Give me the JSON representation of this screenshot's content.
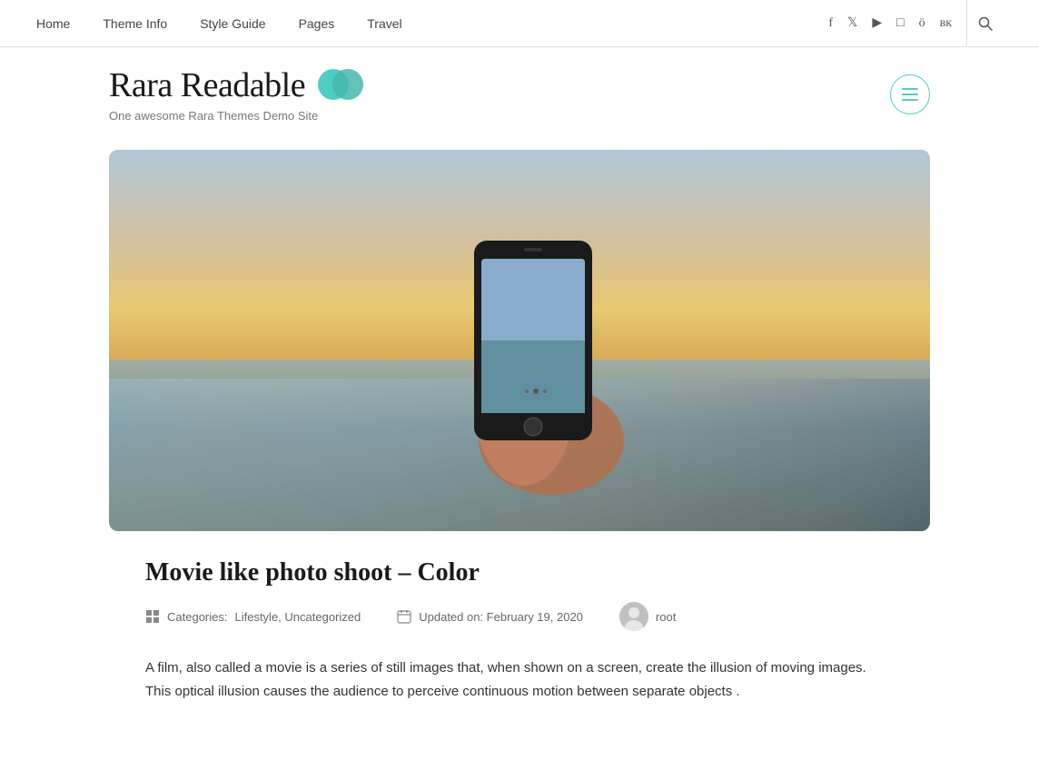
{
  "topnav": {
    "links": [
      {
        "label": "Home",
        "id": "home"
      },
      {
        "label": "Theme Info",
        "id": "theme-info"
      },
      {
        "label": "Style Guide",
        "id": "style-guide"
      },
      {
        "label": "Pages",
        "id": "pages"
      },
      {
        "label": "Travel",
        "id": "travel"
      }
    ],
    "social": [
      {
        "id": "facebook",
        "symbol": "f"
      },
      {
        "id": "twitter",
        "symbol": "𝕏"
      },
      {
        "id": "youtube",
        "symbol": "▶"
      },
      {
        "id": "instagram",
        "symbol": "◻"
      },
      {
        "id": "odnoklassniki",
        "symbol": "ö"
      },
      {
        "id": "vk",
        "symbol": "в"
      }
    ],
    "search_symbol": "🔍"
  },
  "header": {
    "site_title": "Rara Readable",
    "tagline": "One awesome Rara Themes Demo Site",
    "menu_label": "menu"
  },
  "article": {
    "title": "Movie like photo shoot – Color",
    "categories_label": "Categories:",
    "categories": "Lifestyle, Uncategorized",
    "updated_label": "Updated on: February 19, 2020",
    "author": "root",
    "body": "A film, also called a movie is a series of still images that, when shown on a screen, create the illusion of moving images. This optical illusion causes the audience to perceive continuous motion between separate objects ."
  },
  "colors": {
    "accent": "#4ecdc4",
    "text_dark": "#1a1a1a",
    "text_muted": "#777"
  }
}
